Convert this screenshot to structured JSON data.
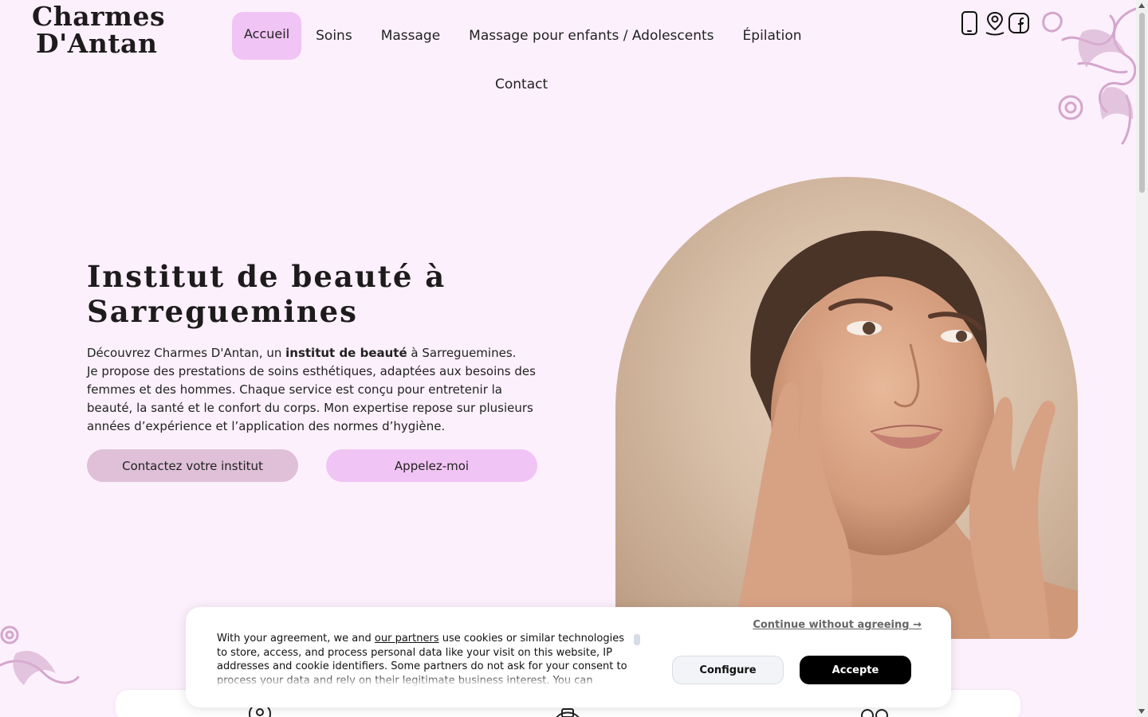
{
  "logo": {
    "line1": "Charmes",
    "line2": "D'Antan"
  },
  "nav": {
    "items": [
      {
        "label": "Accueil"
      },
      {
        "label": "Soins"
      },
      {
        "label": "Massage"
      },
      {
        "label": "Massage pour enfants / Adolescents"
      },
      {
        "label": "Épilation"
      },
      {
        "label": "Contact"
      }
    ],
    "active": "Accueil"
  },
  "top_icons": [
    "phone-icon",
    "map-pin-icon",
    "facebook-icon"
  ],
  "hero": {
    "title_line1": "Institut de beauté à",
    "title_line2": "Sarreguemines",
    "intro_pre": "Découvrez Charmes D'Antan, un ",
    "intro_bold": "institut de beauté",
    "intro_post": " à Sarreguemines.",
    "body": "Je propose des prestations de soins esthétiques, adaptées aux besoins des femmes et des hommes. Chaque service est conçu pour entretenir la beauté, la santé et le confort du corps. Mon expertise repose sur plusieurs années d’expérience et l’application des normes d’hygiène.",
    "btn_contact": "Contactez votre institut",
    "btn_call": "Appelez-moi"
  },
  "cookie": {
    "text_pre": "With your agreement, we and ",
    "partners_link": "our partners",
    "text_post": " use cookies or similar technologies to store, access, and process personal data like your visit on this website, IP addresses and cookie identifiers. Some partners do not ask for your consent to process your data and rely on their legitimate business interest. You can",
    "continue_link": "Continue without agreeing →",
    "configure": "Configure",
    "accept": "Accepte"
  },
  "colors": {
    "background": "#fcf0fc",
    "accent_pink": "#f0c4f4",
    "mauve": "#dfc0d8",
    "flourish": "#d4a6cc"
  }
}
